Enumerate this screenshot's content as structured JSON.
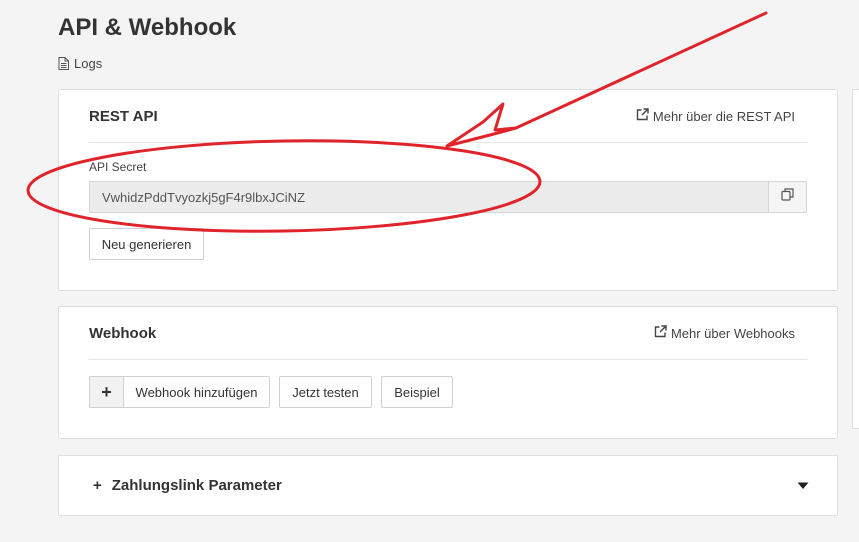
{
  "page": {
    "title": "API & Webhook",
    "logs_label": "Logs"
  },
  "rest_api": {
    "title": "REST API",
    "more_link": "Mehr über die REST API",
    "secret_label": "API Secret",
    "secret_value": "VwhidzPddTvyozkj5gF4r9lbxJCiNZ",
    "regenerate_label": "Neu generieren"
  },
  "webhook": {
    "title": "Webhook",
    "more_link": "Mehr über Webhooks",
    "add_plus": "+",
    "add_label": "Webhook hinzufügen",
    "test_label": "Jetzt testen",
    "example_label": "Beispiel"
  },
  "payment_link": {
    "plus": "+",
    "title": "Zahlungslink Parameter"
  },
  "icons": {
    "logs": "document-icon",
    "external": "external-link-icon",
    "copy": "copy-icon",
    "expand": "caret-down-icon"
  },
  "colors": {
    "annotation": "#e0242b",
    "background": "#f4f4f4",
    "card": "#ffffff",
    "input_bg": "#ececec"
  }
}
